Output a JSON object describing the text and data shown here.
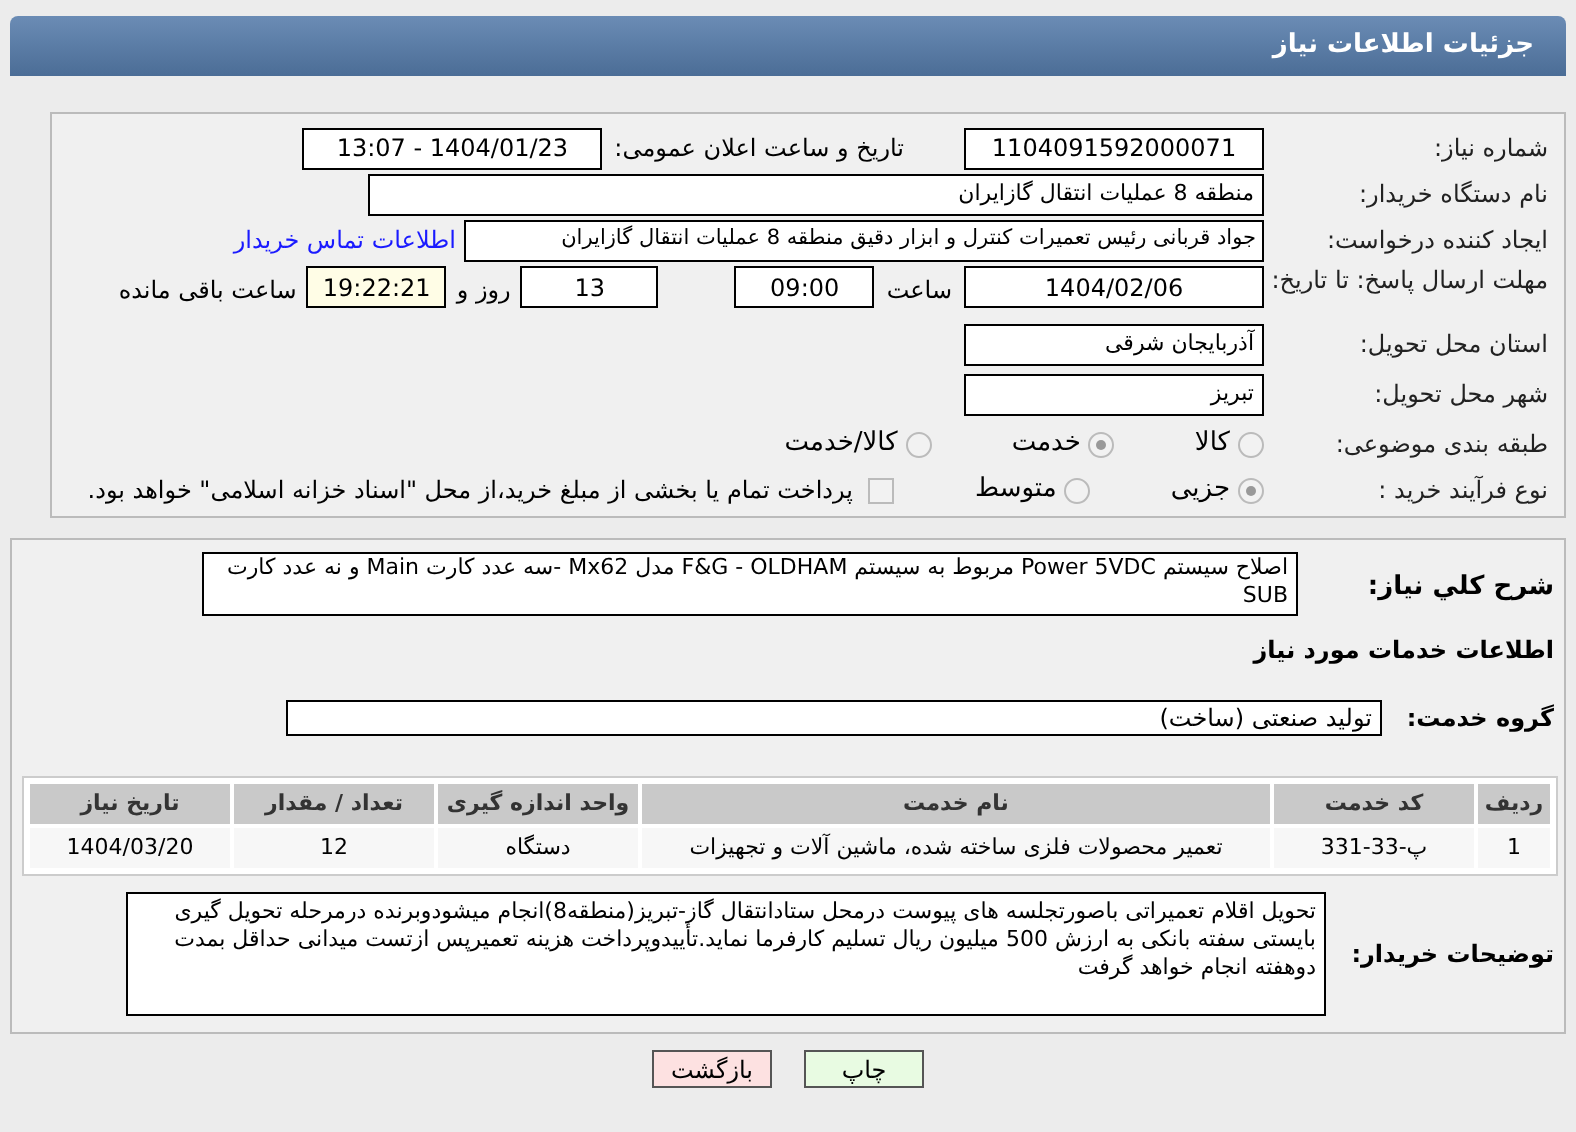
{
  "header": {
    "title": "جزئیات اطلاعات نیاز"
  },
  "need_number": {
    "label": "شماره نیاز:",
    "value": "1104091592000071"
  },
  "announce": {
    "label": "تاریخ و ساعت اعلان عمومی:",
    "value": "1404/01/23 - 13:07"
  },
  "buyer": {
    "label": "نام دستگاه خریدار:",
    "value": "منطقه 8 عملیات انتقال گازایران"
  },
  "creator": {
    "label": "ایجاد کننده درخواست:",
    "value": "جواد قربانی رئیس تعمیرات کنترل و ابزار دقیق منطقه 8 عملیات انتقال گازایران",
    "link": "اطلاعات تماس خریدار"
  },
  "deadline": {
    "label": "مهلت ارسال پاسخ: تا تاریخ:",
    "date": "1404/02/06",
    "time_label": "ساعت",
    "time": "09:00",
    "days": "13",
    "days_label": "روز و",
    "remaining": "19:22:21",
    "remaining_label": "ساعت باقی مانده"
  },
  "province": {
    "label": "استان محل تحویل:",
    "value": "آذربایجان شرقی"
  },
  "city": {
    "label": "شهر محل تحویل:",
    "value": "تبریز"
  },
  "category": {
    "label": "طبقه بندی موضوعی:",
    "options": [
      {
        "label": "کالا",
        "selected": false
      },
      {
        "label": "خدمت",
        "selected": true
      },
      {
        "label": "کالا/خدمت",
        "selected": false
      }
    ]
  },
  "process": {
    "label": "نوع فرآیند خرید :",
    "options": [
      {
        "label": "جزیی",
        "selected": true
      },
      {
        "label": "متوسط",
        "selected": false
      }
    ],
    "payment_checked": false,
    "payment_text": "پرداخت تمام یا بخشی از مبلغ خرید،از محل \"اسناد خزانه اسلامی\" خواهد بود."
  },
  "summary": {
    "label": "شرح كلي نياز:",
    "value": "اصلاح سیستم Power 5VDC مربوط به سیستم F&G - OLDHAM مدل Mx62 -سه عدد کارت Main و نه عدد کارت SUB"
  },
  "services_title": "اطلاعات خدمات مورد نیاز",
  "service_group": {
    "label": "گروه خدمت:",
    "value": "تولید صنعتی (ساخت)"
  },
  "table": {
    "columns": [
      "ردیف",
      "کد خدمت",
      "نام خدمت",
      "واحد اندازه گیری",
      "تعداد / مقدار",
      "تاریخ نیاز"
    ],
    "rows": [
      [
        "1",
        "پ-33-331",
        "تعمیر محصولات فلزی ساخته شده، ماشین آلات و تجهیزات",
        "دستگاه",
        "12",
        "1404/03/20"
      ]
    ]
  },
  "notes": {
    "label": "توضیحات خریدار:",
    "value": "تحویل اقلام تعمیراتی باصورتجلسه های پیوست درمحل ستادانتقال گاز-تبریز(منطقه8)انجام میشودوبرنده درمرحله تحویل گیری بایستی سفته بانکی به ارزش 500 میلیون ریال تسلیم کارفرما نماید.تأییدوپرداخت هزینه تعمیرپس ازتست میدانی حداقل بمدت دوهفته انجام خواهد گرفت"
  },
  "buttons": [
    {
      "label": "چاپ",
      "kind": "print"
    },
    {
      "label": "بازگشت",
      "kind": "back"
    }
  ]
}
